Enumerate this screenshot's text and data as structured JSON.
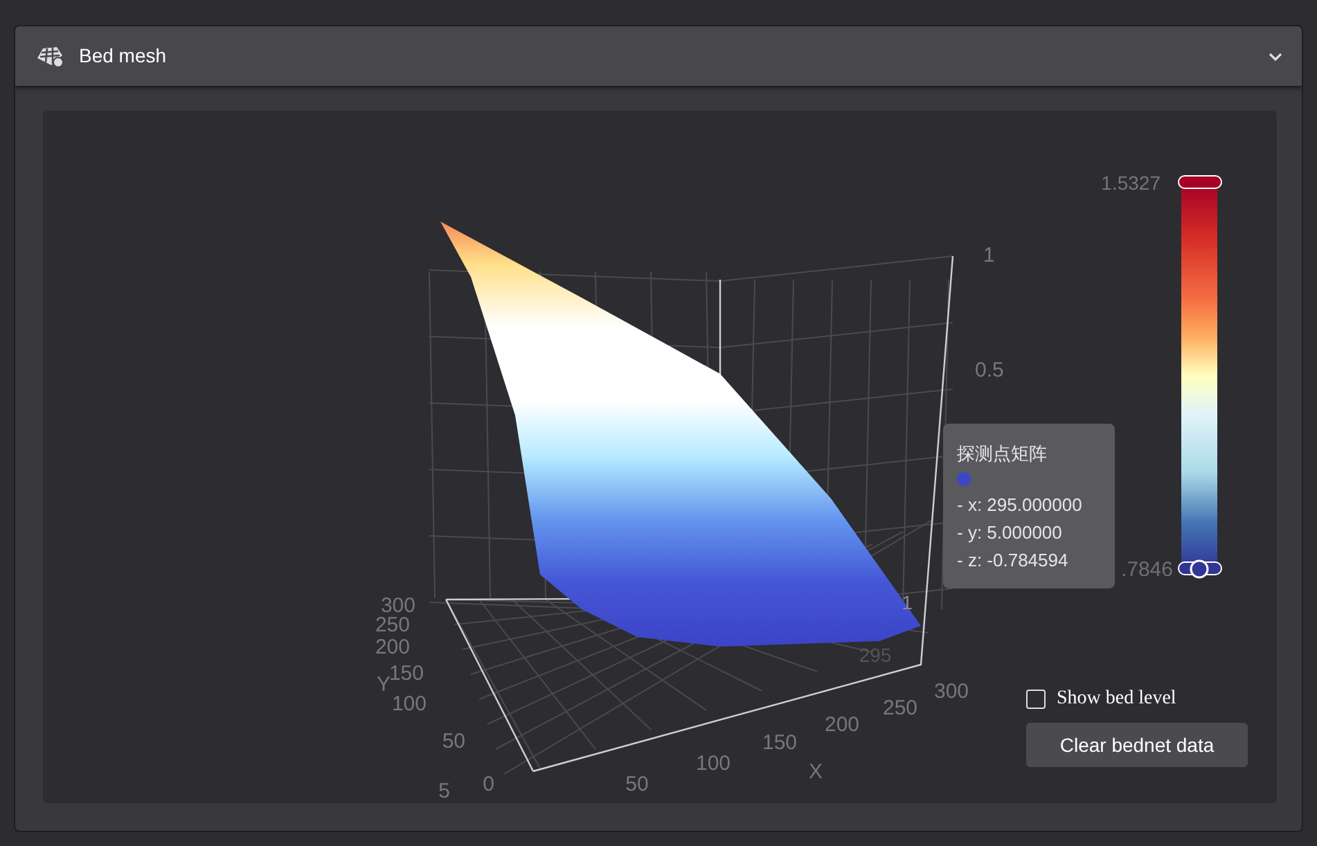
{
  "panel": {
    "title": "Bed mesh",
    "expanded": true
  },
  "chart": {
    "x_axis": {
      "name": "X",
      "ticks": [
        "50",
        "100",
        "150",
        "200",
        "250",
        "300"
      ]
    },
    "y_axis": {
      "name": "Y",
      "ticks": [
        "300",
        "250",
        "200",
        "150",
        "100",
        "50",
        "0"
      ],
      "extra": "5"
    },
    "z_axis": {
      "ticks": [
        "1",
        "0.5"
      ]
    },
    "inner_labels": [
      "1",
      "295"
    ],
    "scale": {
      "max": "1.5327",
      "min": ".7846"
    },
    "tooltip": {
      "title": "探测点矩阵",
      "color": "#3c46c8",
      "lines": [
        "- x: 295.000000",
        "- y: 5.000000",
        "- z: -0.784594"
      ]
    }
  },
  "show_bed_level": {
    "label": "Show bed level",
    "checked": false
  },
  "clear_button": "Clear bednet data"
}
